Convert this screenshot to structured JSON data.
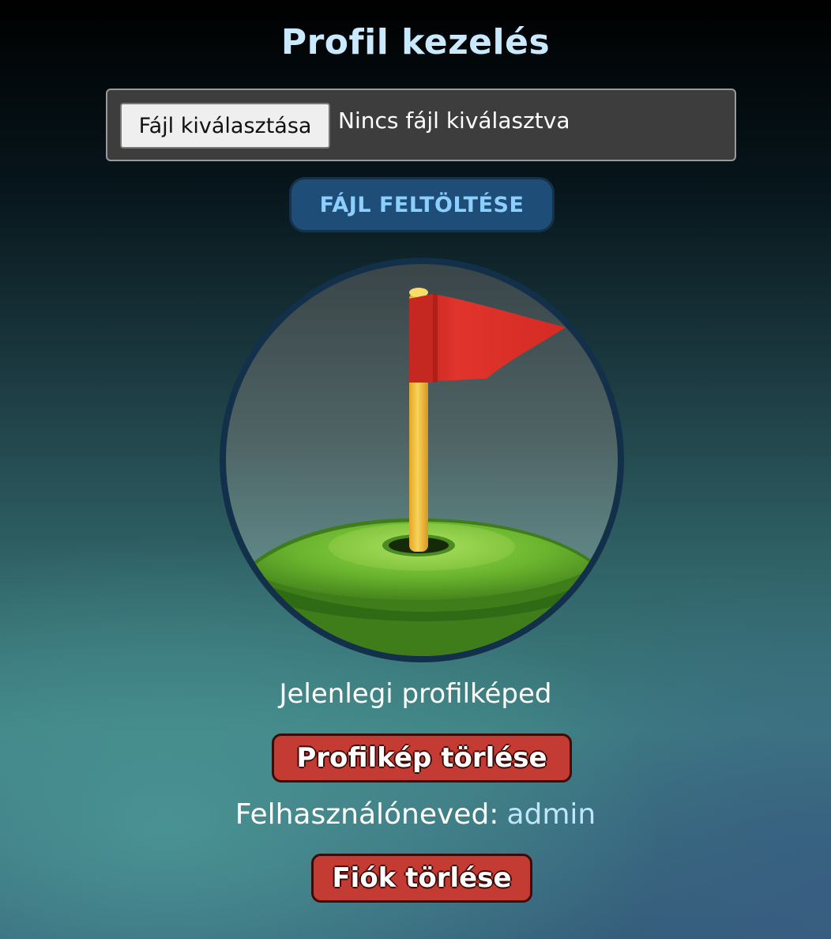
{
  "page": {
    "title": "Profil kezelés"
  },
  "upload": {
    "choose_file_label": "Fájl kiválasztása",
    "no_file_text": "Nincs fájl kiválasztva",
    "upload_button_label": "FÁJL FELTÖLTÉSE"
  },
  "profile": {
    "avatar_icon": "golf-flag-icon",
    "caption": "Jelenlegi profilképed",
    "delete_picture_label": "Profilkép törlése",
    "username_label": "Felhasználóneved:",
    "username_value": "admin",
    "delete_account_label": "Fiók törlése"
  },
  "colors": {
    "title": "#c9e9ff",
    "upload_button_bg": "#1e4d78",
    "upload_button_text": "#8ccfff",
    "danger_button_bg": "#c43b33",
    "username_value": "#bfe6ff",
    "avatar_border": "#13304b"
  }
}
